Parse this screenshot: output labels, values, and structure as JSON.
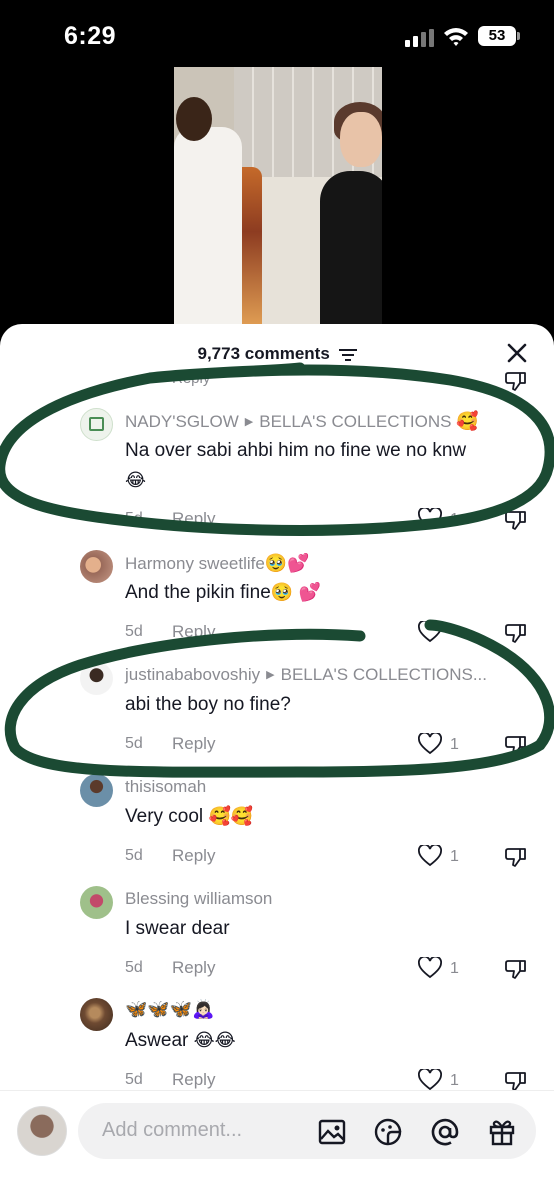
{
  "status_bar": {
    "time": "6:29",
    "battery": "53"
  },
  "sheet": {
    "comments_count": "9,773 comments"
  },
  "comments": [
    {
      "username": "NADY'SGLOW",
      "reply_to": "BELLA'S COLLECTIONS",
      "username_emoji": "🥰",
      "text": "Na over sabi ahbi him no fine we no knw",
      "text_emoji": "😂",
      "age": "5d",
      "reply": "Reply",
      "likes": "1"
    },
    {
      "username": "Harmony sweetlife",
      "username_emoji": "🥹💕",
      "text": "And the pikin fine",
      "text_emoji": "🥹 💕",
      "age": "5d",
      "reply": "Reply",
      "likes": ""
    },
    {
      "username": "justinababovoshiy",
      "reply_to": "BELLA'S COLLECTIONS...",
      "text": "abi the boy no fine?",
      "age": "5d",
      "reply": "Reply",
      "likes": "1"
    },
    {
      "username": "thisisomah",
      "text": "Very cool",
      "text_emoji": "🥰🥰",
      "age": "5d",
      "reply": "Reply",
      "likes": "1"
    },
    {
      "username": "Blessing williamson",
      "text": "I swear dear",
      "age": "5d",
      "reply": "Reply",
      "likes": "1"
    },
    {
      "username": "🦋🦋🦋🙇🏻‍♀️",
      "text": "Aswear",
      "text_emoji": "😂😂",
      "age": "5d",
      "reply": "Reply",
      "likes": "1"
    }
  ],
  "previous_comment": {
    "reply": "Reply"
  },
  "bottom_bar": {
    "placeholder": "Add comment..."
  },
  "icons": [
    "signal-icon",
    "wifi-icon",
    "battery-icon",
    "filter-icon",
    "close-icon",
    "heart-icon",
    "dislike-icon",
    "image-icon",
    "sticker-icon",
    "mention-icon",
    "gift-icon"
  ],
  "colors": {
    "ink": "#1b4a33",
    "secondary_text": "#8a8b91",
    "sheet": "#ffffff"
  }
}
